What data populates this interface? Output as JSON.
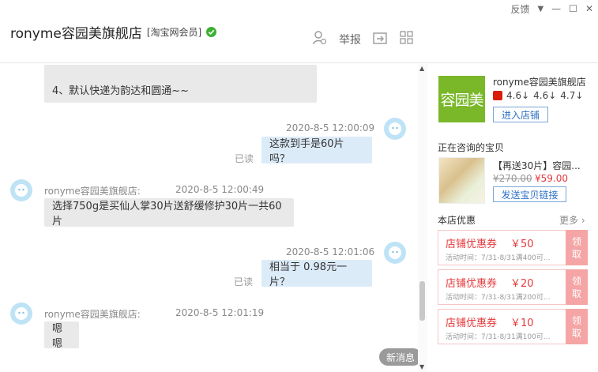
{
  "window_controls": {
    "feedback": "反馈",
    "dropdown": "▼",
    "minimize": "—",
    "maximize": "☐",
    "close": "✕"
  },
  "header": {
    "shop_name": "ronyme容园美旗舰店",
    "tag": "[淘宝网会员]",
    "report_label": "举报"
  },
  "messages": [
    {
      "text": "4、默认快递为韵达和圆通~~"
    },
    {
      "time": "2020-8-5 12:00:09",
      "status": "已读",
      "text": "这款到手是60片吗？"
    },
    {
      "sender": "ronyme容园美旗舰店:",
      "time": "2020-8-5 12:00:49",
      "text": "选择750g是买仙人掌30片送舒缓修护30片一共60片"
    },
    {
      "time": "2020-8-5 12:01:06",
      "status": "已读",
      "text": "相当于 0.98元一片？"
    },
    {
      "sender": "ronyme容园美旗舰店:",
      "time": "2020-8-5 12:01:19",
      "text": "嗯嗯"
    }
  ],
  "new_message_label": "新消息",
  "side": {
    "logo_text": "容园美",
    "shop_name": "ronyme容园美旗舰店",
    "ratings": [
      "4.6↓",
      "4.6↓",
      "4.7↓"
    ],
    "enter_label": "进入店铺",
    "consulting_title": "正在咨询的宝贝",
    "product_title": "【再送30片】容园...",
    "price_old": "¥270.00",
    "price_new": "¥59.00",
    "send_link_label": "发送宝贝链接",
    "discount_title": "本店优惠",
    "more_label": "更多",
    "coupons": [
      {
        "title": "店铺优惠券",
        "amount": "￥50",
        "time": "活动时间：7/31-8/31满400可...",
        "get": "领\n取"
      },
      {
        "title": "店铺优惠券",
        "amount": "￥20",
        "time": "活动时间：7/31-8/31满200可...",
        "get": "领\n取"
      },
      {
        "title": "店铺优惠券",
        "amount": "￥10",
        "time": "活动时间：7/31-8/31满100可...",
        "get": "领\n取"
      }
    ]
  },
  "colors": {
    "accent_green": "#7ab829",
    "coupon_red": "#e4393c",
    "link_blue": "#2d70c5"
  }
}
